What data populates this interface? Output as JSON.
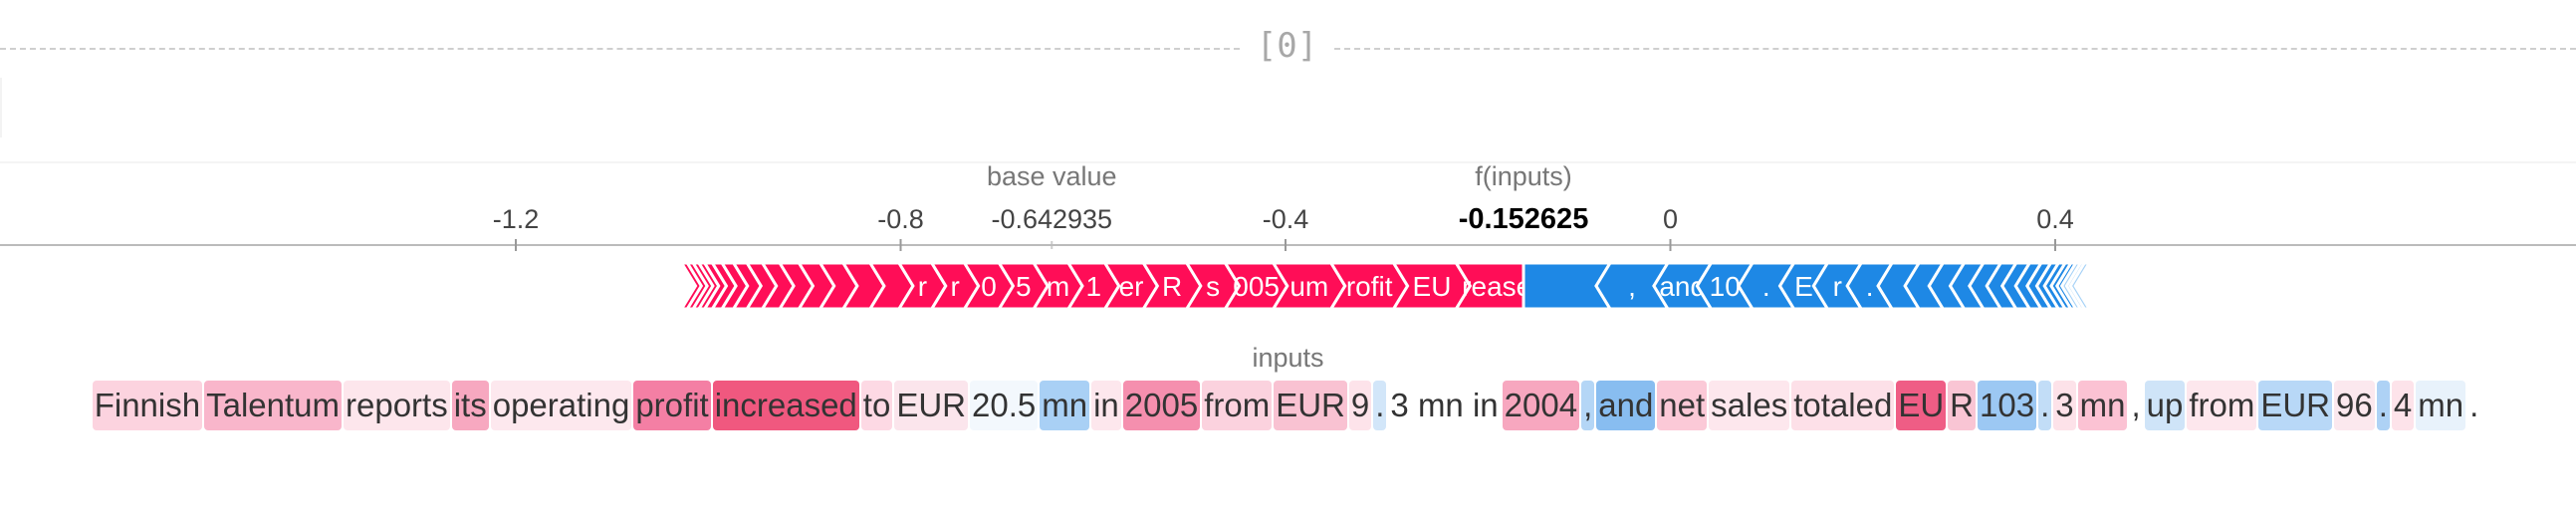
{
  "output_index": "[0]",
  "axis": {
    "min": -1.6,
    "max": 0.8,
    "ticks": [
      {
        "value": -1.2,
        "label": "-1.2"
      },
      {
        "value": -0.8,
        "label": "-0.8"
      },
      {
        "value": -0.4,
        "label": "-0.4"
      },
      {
        "value": 0,
        "label": "0"
      },
      {
        "value": 0.4,
        "label": "0.4"
      }
    ]
  },
  "base_value": {
    "label": "base value",
    "value": -0.642935,
    "text": "-0.642935"
  },
  "output_value": {
    "label": "f(inputs)",
    "value": -0.152625,
    "text": "-0.152625"
  },
  "colors": {
    "positive": "#ff0d57",
    "negative": "#1e88e5",
    "negative_tail": "#a6d2f7"
  },
  "positive_segments": [
    {
      "label": "",
      "value": 0.006
    },
    {
      "label": "",
      "value": 0.006
    },
    {
      "label": "",
      "value": 0.006
    },
    {
      "label": "",
      "value": 0.006
    },
    {
      "label": "",
      "value": 0.008
    },
    {
      "label": "",
      "value": 0.01
    },
    {
      "label": "",
      "value": 0.012
    },
    {
      "label": "",
      "value": 0.014
    },
    {
      "label": "",
      "value": 0.016
    },
    {
      "label": "",
      "value": 0.018
    },
    {
      "label": "",
      "value": 0.02
    },
    {
      "label": "",
      "value": 0.022
    },
    {
      "label": "",
      "value": 0.024
    },
    {
      "label": "",
      "value": 0.028
    },
    {
      "label": "",
      "value": 0.03
    },
    {
      "label": "r",
      "value": 0.034
    },
    {
      "label": "r",
      "value": 0.034
    },
    {
      "label": "0",
      "value": 0.036
    },
    {
      "label": "5",
      "value": 0.036
    },
    {
      "label": "m",
      "value": 0.036
    },
    {
      "label": "1",
      "value": 0.038
    },
    {
      "label": "er",
      "value": 0.04
    },
    {
      "label": "R",
      "value": 0.045
    },
    {
      "label": "s",
      "value": 0.04
    },
    {
      "label": "005",
      "value": 0.05
    },
    {
      "label": "um",
      "value": 0.06
    },
    {
      "label": "rofit",
      "value": 0.065
    },
    {
      "label": "EU",
      "value": 0.065
    },
    {
      "label": "rease",
      "value": 0.07
    }
  ],
  "negative_segments": [
    {
      "label": "",
      "value": 0.09
    },
    {
      "label": ",",
      "value": 0.06
    },
    {
      "label": "and",
      "value": 0.045
    },
    {
      "label": "10",
      "value": 0.043
    },
    {
      "label": ".",
      "value": 0.043
    },
    {
      "label": "E",
      "value": 0.035
    },
    {
      "label": "r",
      "value": 0.035
    },
    {
      "label": ".",
      "value": 0.032
    },
    {
      "label": "",
      "value": 0.028
    },
    {
      "label": "",
      "value": 0.025
    },
    {
      "label": "",
      "value": 0.022
    },
    {
      "label": "",
      "value": 0.02
    },
    {
      "label": "",
      "value": 0.018
    },
    {
      "label": "",
      "value": 0.016
    },
    {
      "label": "",
      "value": 0.014
    },
    {
      "label": "",
      "value": 0.012
    },
    {
      "label": "",
      "value": 0.01
    },
    {
      "label": "",
      "value": 0.008
    },
    {
      "label": "",
      "value": 0.007
    },
    {
      "label": "",
      "value": 0.006
    },
    {
      "label": "",
      "value": 0.005
    },
    {
      "label": "",
      "value": 0.005
    },
    {
      "label": "",
      "value": 0.004
    },
    {
      "label": "",
      "value": 0.005
    }
  ],
  "inputs_title": "inputs",
  "tokens": [
    {
      "text": "Finnish ",
      "bg": "#fcd3df"
    },
    {
      "text": "Talentum",
      "bg": "#f9b6cb"
    },
    {
      "text": " reports ",
      "bg": "#fde6ec"
    },
    {
      "text": "its",
      "bg": "#f7a8c0"
    },
    {
      "text": " operating ",
      "bg": "#fde8ee"
    },
    {
      "text": "profit ",
      "bg": "#f47fa4"
    },
    {
      "text": "increased",
      "bg": "#f0587f"
    },
    {
      "text": " to ",
      "bg": "#fdd9e4"
    },
    {
      "text": "EUR ",
      "bg": "#fbe5ec"
    },
    {
      "text": "20.5 ",
      "bg": "#f3f8fd"
    },
    {
      "text": "mn",
      "bg": "#a9d0f5"
    },
    {
      "text": " in ",
      "bg": "#fde7ed"
    },
    {
      "text": "2005",
      "bg": "#f58fae"
    },
    {
      "text": " from ",
      "bg": "#fbd2de"
    },
    {
      "text": "EUR",
      "bg": "#f9c2d2"
    },
    {
      "text": " 9",
      "bg": "#fde3ea"
    },
    {
      "text": ".",
      "bg": "#d2e6f9"
    },
    {
      "text": "3 mn in ",
      "bg": "#ffffff"
    },
    {
      "text": "2004",
      "bg": "#f7a7bf"
    },
    {
      "text": " ,",
      "bg": "#b4d6f6"
    },
    {
      "text": " and",
      "bg": "#88bdf0"
    },
    {
      "text": " net ",
      "bg": "#fbc9d7"
    },
    {
      "text": "sales ",
      "bg": "#fde7ed"
    },
    {
      "text": "totaled ",
      "bg": "#fde0e8"
    },
    {
      "text": "EU",
      "bg": "#ef5d85"
    },
    {
      "text": "R ",
      "bg": "#f9c5d4"
    },
    {
      "text": "103",
      "bg": "#9cc8f3"
    },
    {
      "text": ".",
      "bg": "#c2ddf7"
    },
    {
      "text": "3 ",
      "bg": "#fde2e9"
    },
    {
      "text": "mn",
      "bg": "#fbc2d3"
    },
    {
      "text": " , ",
      "bg": "#ffffff"
    },
    {
      "text": "up",
      "bg": "#cfe4f8"
    },
    {
      "text": " from ",
      "bg": "#fde7ed"
    },
    {
      "text": "EUR",
      "bg": "#b8d8f7"
    },
    {
      "text": " 96",
      "bg": "#fbe8ee"
    },
    {
      "text": ".",
      "bg": "#aed2f5"
    },
    {
      "text": "4 ",
      "bg": "#fde3ea"
    },
    {
      "text": "mn",
      "bg": "#e8f2fb"
    },
    {
      "text": " .",
      "bg": "#ffffff"
    }
  ]
}
